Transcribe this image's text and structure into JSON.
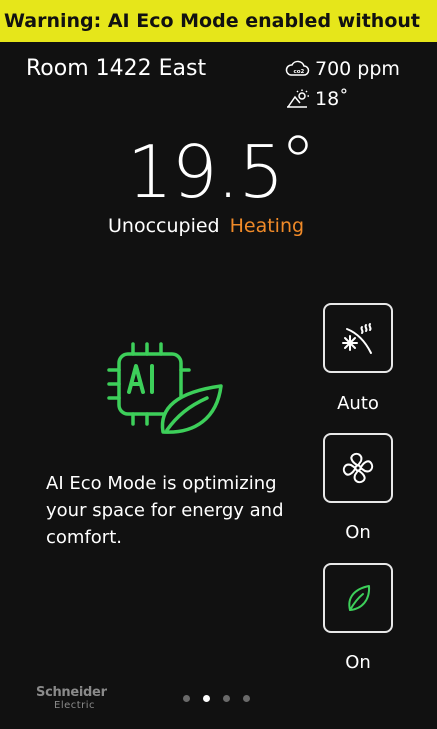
{
  "warning": {
    "text": "Warning: AI Eco Mode enabled without",
    "color": "#e6e61a"
  },
  "header": {
    "room_name": "Room 1422 East"
  },
  "environment": {
    "co2": {
      "icon": "co2-cloud-icon",
      "value": "700 ppm"
    },
    "outdoor_temp": {
      "icon": "outdoor-weather-icon",
      "value": "18˚"
    }
  },
  "thermostat": {
    "temperature": "19.5",
    "degree_icon": "degree-icon",
    "occupancy": "Unoccupied",
    "mode": "Heating",
    "mode_color": "#f08a28"
  },
  "eco": {
    "icon": "ai-chip-leaf-icon",
    "icon_color": "#3dcf5a",
    "message": "AI Eco Mode is optimizing your space for energy and comfort."
  },
  "controls": [
    {
      "icon": "heat-cool-mode-icon",
      "label": "Auto"
    },
    {
      "icon": "fan-icon",
      "label": "On"
    },
    {
      "icon": "eco-leaf-icon",
      "label": "On"
    }
  ],
  "footer": {
    "brand_main": "Schneider",
    "brand_sub": "Electric",
    "page_count": 4,
    "active_page": 2
  }
}
